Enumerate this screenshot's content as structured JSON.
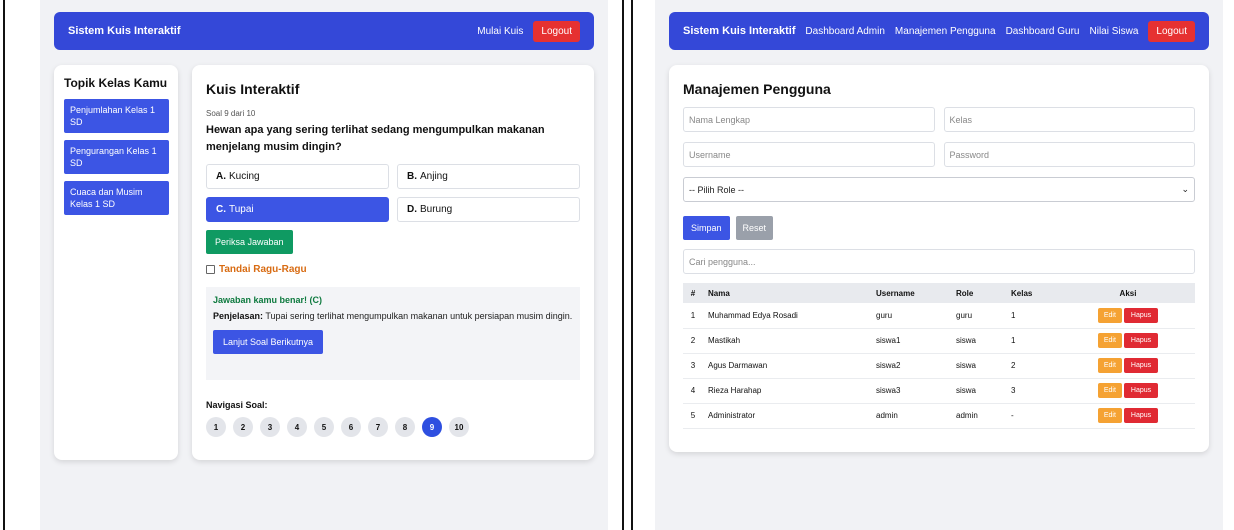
{
  "left": {
    "navbar": {
      "brand": "Sistem Kuis Interaktif",
      "links": [
        "Mulai Kuis"
      ],
      "logout_label": "Logout"
    },
    "sidebar": {
      "heading": "Topik Kelas Kamu",
      "topics": [
        "Penjumlahan Kelas 1 SD",
        "Pengurangan Kelas 1 SD",
        "Cuaca dan Musim Kelas 1 SD"
      ]
    },
    "quiz": {
      "title": "Kuis Interaktif",
      "counter": "Soal 9 dari 10",
      "question": "Hewan apa yang sering terlihat sedang mengumpulkan makanan menjelang musim dingin?",
      "options": [
        {
          "letter": "A.",
          "text": "Kucing",
          "selected": false
        },
        {
          "letter": "B.",
          "text": "Anjing",
          "selected": false
        },
        {
          "letter": "C.",
          "text": "Tupai",
          "selected": true
        },
        {
          "letter": "D.",
          "text": "Burung",
          "selected": false
        }
      ],
      "check_label": "Periksa Jawaban",
      "doubt_label": "Tandai Ragu-Ragu",
      "feedback": {
        "correct": "Jawaban kamu benar! (C)",
        "explain_label": "Penjelasan:",
        "explain_text": " Tupai sering terlihat mengumpulkan makanan untuk persiapan musim dingin.",
        "next_label": "Lanjut Soal Berikutnya"
      },
      "nav_label": "Navigasi Soal:",
      "numbers": [
        "1",
        "2",
        "3",
        "4",
        "5",
        "6",
        "7",
        "8",
        "9",
        "10"
      ],
      "current_number": "9"
    }
  },
  "right": {
    "navbar": {
      "brand": "Sistem Kuis Interaktif",
      "links": [
        "Dashboard Admin",
        "Manajemen Pengguna",
        "Dashboard Guru",
        "Nilai Siswa"
      ],
      "logout_label": "Logout"
    },
    "users": {
      "title": "Manajemen Pengguna",
      "placeholders": {
        "name": "Nama Lengkap",
        "class": "Kelas",
        "username": "Username",
        "password": "Password",
        "search": "Cari pengguna..."
      },
      "role_select": "-- Pilih Role --",
      "save_label": "Simpan",
      "reset_label": "Reset",
      "columns": [
        "#",
        "Nama",
        "Username",
        "Role",
        "Kelas",
        "Aksi"
      ],
      "rows": [
        [
          "1",
          "Muhammad Edya Rosadi",
          "guru",
          "guru",
          "1"
        ],
        [
          "2",
          "Mastikah",
          "siswa1",
          "siswa",
          "1"
        ],
        [
          "3",
          "Agus Darmawan",
          "siswa2",
          "siswa",
          "2"
        ],
        [
          "4",
          "Rieza Harahap",
          "siswa3",
          "siswa",
          "3"
        ],
        [
          "5",
          "Administrator",
          "admin",
          "admin",
          "-"
        ]
      ],
      "edit_label": "Edit",
      "delete_label": "Hapus"
    }
  },
  "colors": {
    "navbar": "#3448d8",
    "primary": "#3c55e4",
    "success": "#0f9a62",
    "danger": "#e02a33",
    "warning": "#f5a233",
    "background": "#f1f2f5"
  }
}
